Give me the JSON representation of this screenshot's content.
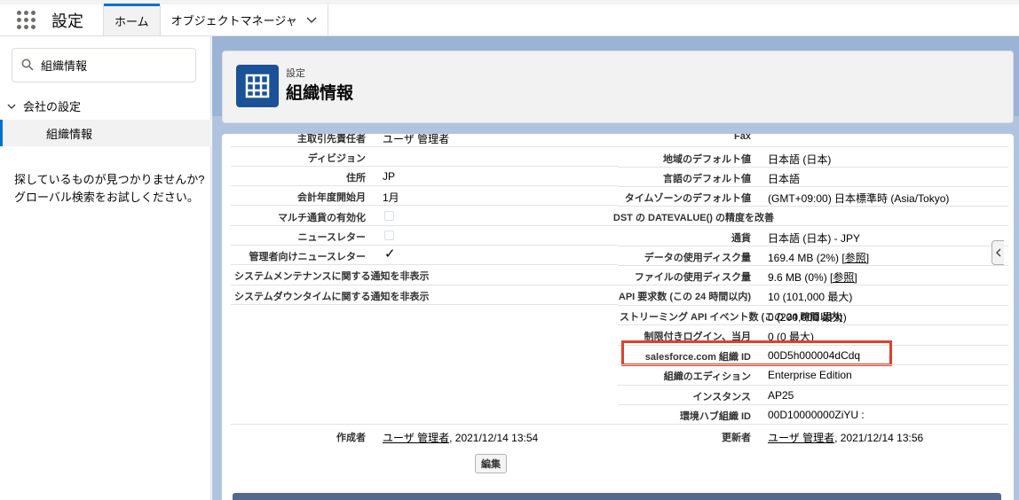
{
  "topnav": {
    "app_name": "設定",
    "tabs": [
      {
        "label": "ホーム"
      },
      {
        "label": "オブジェクトマネージャ"
      }
    ]
  },
  "sidebar": {
    "search_value": "組織情報",
    "tree_parent": "会社の設定",
    "tree_child": "組織情報",
    "not_found_line1": "探しているものが見つかりませんか?",
    "not_found_line2": "グローバル検索をお試しください。"
  },
  "header": {
    "eyebrow": "設定",
    "title": "組織情報"
  },
  "left_fields": [
    {
      "label": "主取引先責任者",
      "value": "ユーザ 管理者"
    },
    {
      "label": "ディビジョン",
      "value": ""
    },
    {
      "label": "住所",
      "value": "JP"
    },
    {
      "label": "会計年度開始月",
      "value": "1月"
    },
    {
      "label": "マルチ通貨の有効化",
      "value": ""
    },
    {
      "label": "ニュースレター",
      "value": ""
    },
    {
      "label": "管理者向けニュースレター",
      "value": "✓"
    },
    {
      "label": "システムメンテナンスに関する通知を非表示",
      "value": ""
    },
    {
      "label": "システムダウンタイムに関する通知を非表示",
      "value": ""
    }
  ],
  "right_fields": [
    {
      "label": "Fax",
      "value": ""
    },
    {
      "label": "地域のデフォルト値",
      "value": "日本語 (日本)"
    },
    {
      "label": "言語のデフォルト値",
      "value": "日本語"
    },
    {
      "label": "タイムゾーンのデフォルト値",
      "value": "(GMT+09:00) 日本標準時 (Asia/Tokyo)"
    },
    {
      "label": "DST の DATEVALUE() の精度を改善",
      "value": ""
    },
    {
      "label": "通貨",
      "value": "日本語 (日本) - JPY"
    },
    {
      "label": "データの使用ディスク量",
      "value": "169.4 MB (2%)",
      "link": "[参照]"
    },
    {
      "label": "ファイルの使用ディスク量",
      "value": "9.6 MB (0%)",
      "link": "[参照]"
    },
    {
      "label": "API 要求数 (この 24 時間以内)",
      "value": "10 (101,000 最大)"
    },
    {
      "label": "ストリーミング API イベント数 (この 24 時間以内)",
      "value": "0 (200,000 最大)"
    },
    {
      "label": "制限付きログイン、当月",
      "value": "0 (0 最大)"
    },
    {
      "label": "salesforce.com 組織 ID",
      "value": "00D5h000004dCdq"
    },
    {
      "label": "組織のエディション",
      "value": "Enterprise Edition"
    },
    {
      "label": "インスタンス",
      "value": "AP25"
    },
    {
      "label": "環境ハブ組織 ID",
      "value": "00D10000000ZiYU :"
    }
  ],
  "created": {
    "label": "作成者",
    "user": "ユーザ 管理者",
    "date": ", 2021/12/14 13:54"
  },
  "modified": {
    "label": "更新者",
    "user": "ユーザ 管理者",
    "date": ", 2021/12/14 13:56"
  },
  "edit_button": "編集",
  "colors": {
    "accent": "#0070d2",
    "highlight": "#e0402c",
    "icon_bg": "#1b5297",
    "bg": "#b0c4df"
  }
}
